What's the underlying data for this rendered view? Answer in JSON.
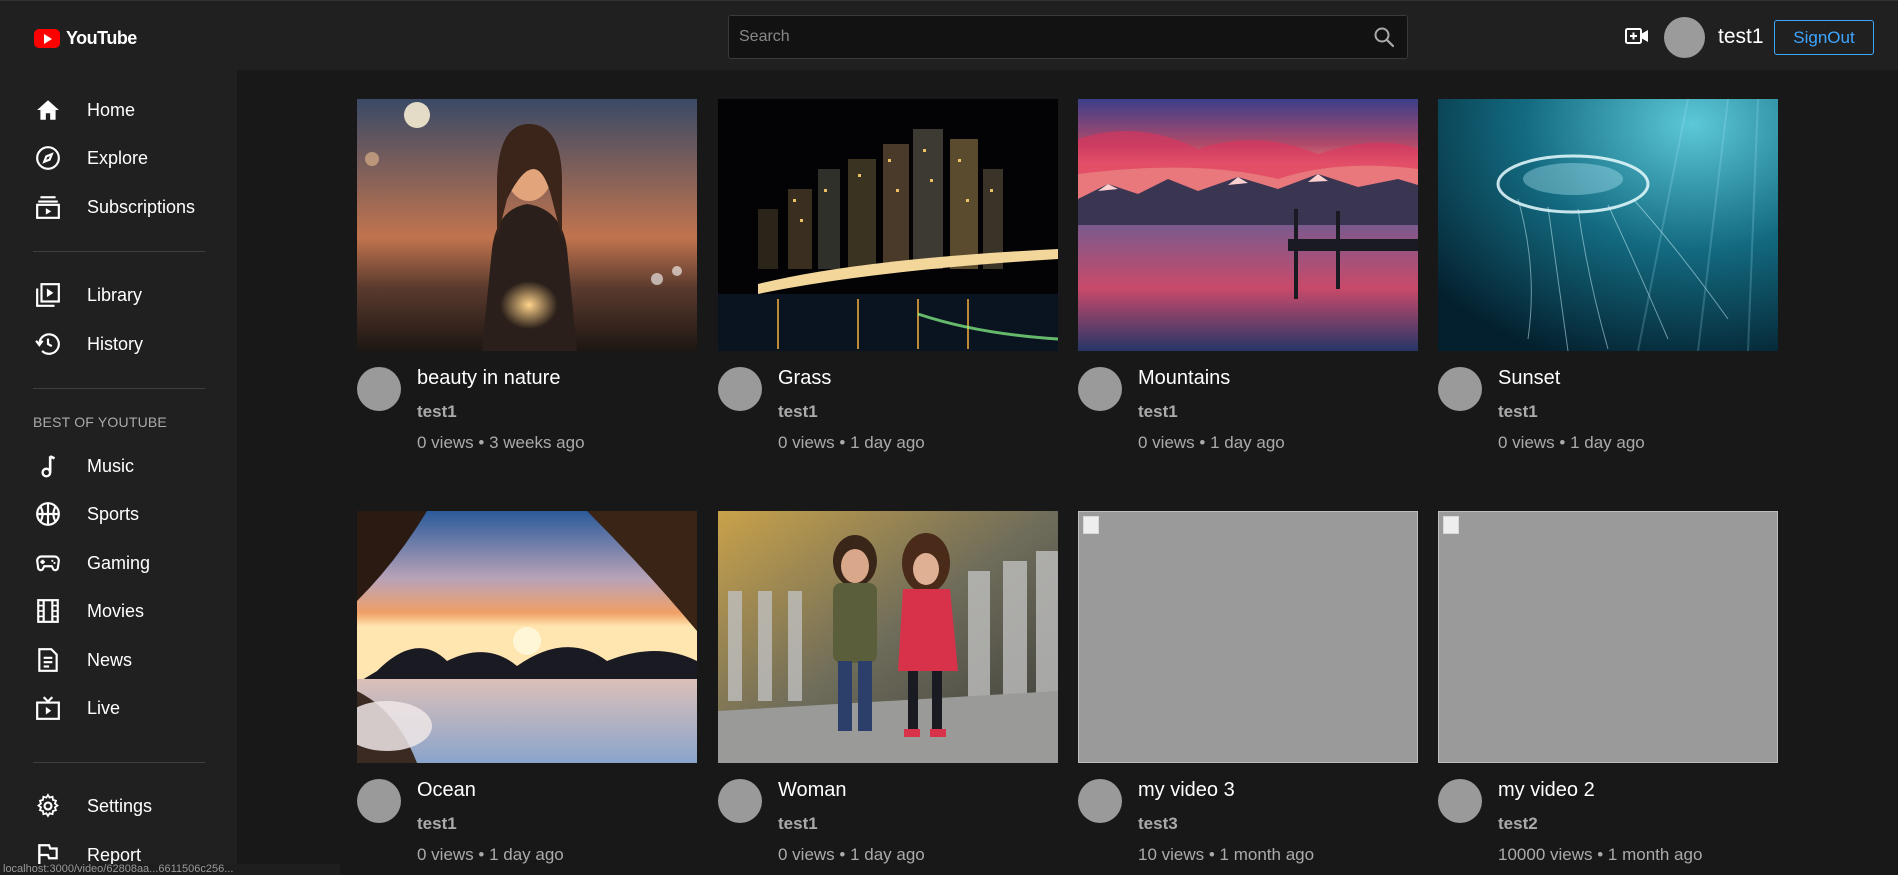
{
  "header": {
    "logo_text": "YouTube",
    "search_placeholder": "Search",
    "username": "test1",
    "signout_label": "SignOut"
  },
  "sidebar": {
    "items": [
      {
        "label": "Home",
        "icon": "home-icon"
      },
      {
        "label": "Explore",
        "icon": "compass-icon"
      },
      {
        "label": "Subscriptions",
        "icon": "subscriptions-icon"
      },
      {
        "label": "Library",
        "icon": "library-icon"
      },
      {
        "label": "History",
        "icon": "history-icon"
      },
      {
        "label": "Music",
        "icon": "music-note-icon"
      },
      {
        "label": "Sports",
        "icon": "basketball-icon"
      },
      {
        "label": "Gaming",
        "icon": "gamepad-icon"
      },
      {
        "label": "Movies",
        "icon": "film-icon"
      },
      {
        "label": "News",
        "icon": "newspaper-icon"
      },
      {
        "label": "Live",
        "icon": "live-tv-icon"
      },
      {
        "label": "Settings",
        "icon": "gear-icon"
      },
      {
        "label": "Report",
        "icon": "flag-icon"
      }
    ],
    "section_title": "BEST OF YOUTUBE",
    "status_url": "localhost:3000/video/62808aa...6611506c256..."
  },
  "videos": [
    {
      "title": "beauty in nature",
      "channel": "test1",
      "stats": "0 views • 3 weeks ago",
      "thumbnail": "woman-with-lights"
    },
    {
      "title": "Grass",
      "channel": "test1",
      "stats": "0 views • 1 day ago",
      "thumbnail": "city-night"
    },
    {
      "title": "Mountains",
      "channel": "test1",
      "stats": "0 views • 1 day ago",
      "thumbnail": "mountain-lake"
    },
    {
      "title": "Sunset",
      "channel": "test1",
      "stats": "0 views • 1 day ago",
      "thumbnail": "jellyfish"
    },
    {
      "title": "Ocean",
      "channel": "test1",
      "stats": "0 views • 1 day ago",
      "thumbnail": "winter-sunset"
    },
    {
      "title": "Woman",
      "channel": "test1",
      "stats": "0 views • 1 day ago",
      "thumbnail": "two-children"
    },
    {
      "title": "my video 3",
      "channel": "test3",
      "stats": "10 views • 1 month ago",
      "thumbnail": "missing"
    },
    {
      "title": "my video 2",
      "channel": "test2",
      "stats": "10000 views • 1 month ago",
      "thumbnail": "missing"
    }
  ],
  "colors": {
    "background": "#181818",
    "surface": "#202020",
    "accent_blue": "#3ea6ff",
    "brand_red": "#ff0000",
    "secondary_text": "#aaaaaa"
  }
}
